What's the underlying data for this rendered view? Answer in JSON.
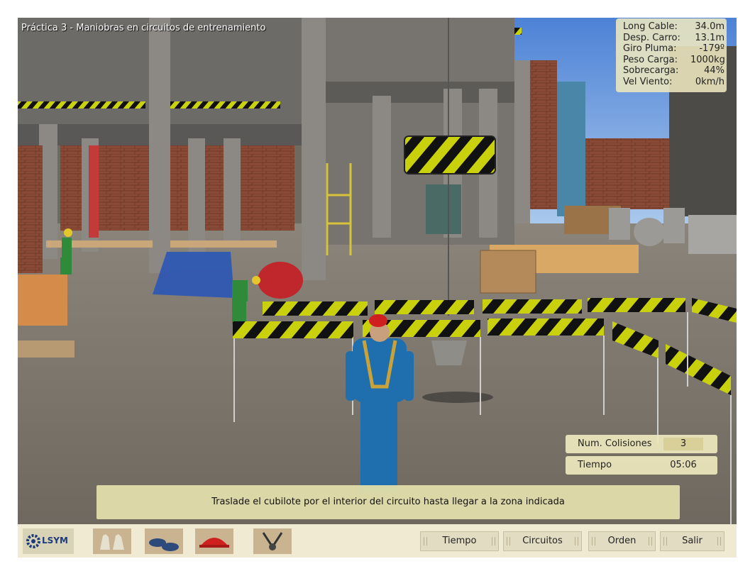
{
  "hud": {
    "title": "Práctica 3 - Maniobras en circuitos de entrenamiento",
    "stats": [
      {
        "label": "Long Cable:",
        "value": "34.0m"
      },
      {
        "label": "Desp. Carro:",
        "value": "13.1m"
      },
      {
        "label": "Giro Pluma:",
        "value": "-179º"
      },
      {
        "label": "Peso Carga:",
        "value": "1000kg"
      },
      {
        "label": "Sobrecarga:",
        "value": "44%"
      },
      {
        "label": "Vel Viento:",
        "value": "0km/h"
      }
    ],
    "collisions_label": "Num. Colisiones",
    "collisions_value": "3",
    "time_label": "Tiempo",
    "time_value": "05:06",
    "instruction": "Traslade el cubilote por el interior del circuito hasta llegar a la zona indicada"
  },
  "toolbar": {
    "logo_text": "LSYM",
    "buttons": [
      "Tiempo",
      "Circuitos",
      "Orden",
      "Salir"
    ]
  },
  "colors": {
    "hazard_yellow": "#d4d80a",
    "worker_blue": "#1f6fae",
    "hud_panel": "#eee8be",
    "toolbar": "#f0ead3"
  }
}
